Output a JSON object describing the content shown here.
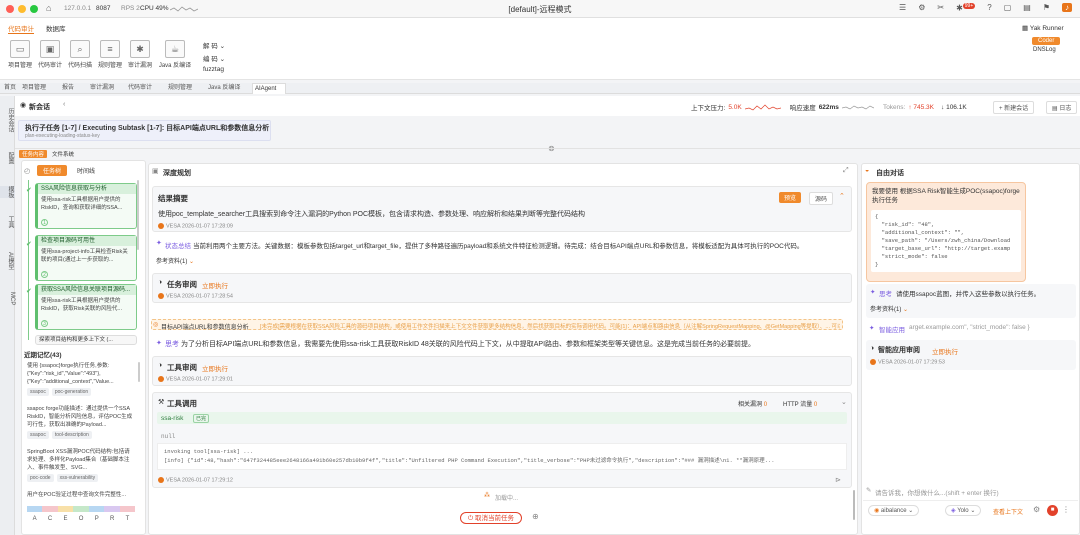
{
  "titlebar": {
    "host": "127.0.0.1",
    "port": "8087",
    "rps": "RPS 2",
    "cpu": "CPU 49%",
    "window_title": "[default]-远程模式",
    "notif_count": "99+"
  },
  "ribbon": {
    "tabs": [
      "代码审计",
      "数据库"
    ],
    "active_tab": "代码审计",
    "items": [
      "项目管理",
      "代码审计",
      "代码扫描",
      "规则管理",
      "审计漏洞",
      "Java 反编译"
    ],
    "dropdowns": [
      "解 码",
      "编 码",
      "fuzztag"
    ],
    "right_title": "Yak Runner",
    "right_badge": "Coder",
    "right_item": "DNSLog"
  },
  "tabs": [
    "首页",
    "项目管理",
    "报告",
    "审计漏洞",
    "代码审计",
    "规则管理",
    "Java 反编译",
    "AIAgent"
  ],
  "active_tab_index": 7,
  "rail": [
    "历史会话",
    "配置",
    "模板",
    "工具",
    "AI模型",
    "MCP"
  ],
  "session": {
    "title": "新会话",
    "pressure_label": "上下文压力:",
    "pressure_value": "5.0K",
    "speed_label": "响应速度",
    "speed_value": "622ms",
    "tokens_label": "Tokens:",
    "tokens_up": "745.3K",
    "tokens_down": "106.1K",
    "new_btn": "新建会话",
    "log_btn": "日志"
  },
  "banner": {
    "title": "执行子任务 [1-7] / Executing Subtask [1-7]: 目标API端点URL和参数信息分析",
    "subtitle": "plan-executing-loading-status-key"
  },
  "left": {
    "tabs": [
      "任务内容",
      "文件系统"
    ],
    "subtabs": [
      "任务树",
      "时间线"
    ],
    "tasks": [
      {
        "title": "SSA风险信息获取与分析",
        "body": "使用ssa-risk工具根据用户提供的RiskID，查询和获取详细的SSA...",
        "n": "1"
      },
      {
        "title": "检查项目源码可用性",
        "body": "使用ssa-project-info工具检查Risk关联的项目(通过上一步获取的...",
        "n": "2"
      },
      {
        "title": "获取SSA风险信息关联项目源码...",
        "body": "使用ssa-risk工具根据用户提供的RiskID，获取Risk关联的风险代...",
        "n": "3"
      }
    ],
    "task4": "探索项目结构和更多上下文 (...",
    "memory_title": "近期记忆(43)",
    "memories": [
      {
        "text": "使用 {ssapoc}forge执行任务,参数: {\"Key\":\"risk_id\",\"Value\":\"493\"},{\"Key\":\"additional_context\",\"Value...",
        "tags": [
          "ssapoc",
          "poc-generation"
        ]
      },
      {
        "text": "ssapoc forge功能描述：通过提供一个SSA RiskID，智能分析风险信息，评估POC生成可行性，获取出准确的Payload...",
        "tags": [
          "ssapoc",
          "tool-description"
        ]
      },
      {
        "text": "SpringBoot XSS漏洞POC代码结构:包括请求处理、多样化Payload集合（基础脚本注入、事件触发型、SVG...",
        "tags": [
          "poc-code",
          "xss-vulnerability"
        ]
      },
      {
        "text": "用户在POC验证过程中查询文件完整性...",
        "tags": []
      }
    ],
    "letters": [
      "A",
      "C",
      "E",
      "O",
      "P",
      "R",
      "T"
    ]
  },
  "mid": {
    "title": "深度规划",
    "result_title": "结果摘要",
    "preview_btn": "预览",
    "source_btn": "源码",
    "result_text": "使用poc_template_searcher工具搜索到命令注入漏洞的Python POC模板，包含请求构造、参数处理、响应解析和结果判断等完整代码结构",
    "meta1": "VESA  2026-01-07 17:28:09",
    "status_label": "状态总结",
    "status_text": "当前利用两个主要方法。关键数据：模板参数包括target_url和target_file，提供了多种路径遍历payload和系统文件特征检测逻辑。待完成：结合目标API端点URL和参数信息，将模板适配为具体可执行的POC代码。",
    "ref1": "参考资料(1)",
    "review_title": "任务审阅",
    "review_action": "立即执行",
    "meta2": "VESA  2026-01-07 17:28:54",
    "progress_label": "目标API端点URL和参数信息分析",
    "progress_text": "[未完成]需要根据在获取SSA风险工具的源码项目结构，或使用工作文件扫描来上下文文件获取更多结构信息，然后找获取目标的实际调用代码。可能(1)：API端点和路由信息（从注解SpringRequestMapping、@GetMapping等提取）、... 可以下载...",
    "think_label": "思考",
    "think_text": "为了分析目标API端点URL和参数信息，我需要先使用ssa-risk工具获取RiskID 48关联的风险代码上下文，从中提取API路由、参数和框架类型等关键信息。这是完成当前任务的必要前提。",
    "tool_review_title": "工具审阅",
    "tool_review_action": "立即执行",
    "meta3": "VESA  2026-01-07 17:29:01",
    "tool_call_title": "工具调用",
    "related": "相关漏洞",
    "related_n": "0",
    "http": "HTTP 流量",
    "http_n": "0",
    "tool_name": "ssa-risk",
    "tool_badge": "已完",
    "null_text": "null",
    "log1": "invoking tool[ssa-risk] ...",
    "log2": "[info] {\"id\":48,\"hash\":\"647f324485eee2648166a491b60e257db10b9f4f\",\"title\":\"Unfiltered PHP Command Execution\",\"title_verbose\":\"PHP未过滤命令执行\",\"description\":\"### 漏洞描述\\n1. **漏洞原理...",
    "meta4": "VESA  2026-01-07 17:29:12",
    "loading": "加载中...",
    "cancel_btn": "取消当前任务"
  },
  "right": {
    "title": "自由对话",
    "user_msg": "我要使用 根据SSA Risk智能生成POC(ssapoc)forge执行任务",
    "code": [
      "{",
      "  \"risk_id\": \"48\",",
      "  \"additional_context\": \"\",",
      "  \"save_path\": \"/Users/zwh_china/Download",
      "  \"target_base_url\": \"http://target.examp",
      "  \"strict_mode\": false",
      "}"
    ],
    "think_label": "思考",
    "think_text": "请使用ssapoc蓝图，并传入这些参数以执行任务。",
    "ref": "参考资料(1)",
    "app_label": "智能应用",
    "app_text": "arget.example.com\", \"strict_mode\": false }",
    "review_title": "智能应用审阅",
    "review_action": "立即执行",
    "meta": "VESA  2026-01-07 17:29:53",
    "input_placeholder": "请告诉我，你想做什么...(shift + enter 换行)",
    "model": "aibalance",
    "mode": "Yolo",
    "context_btn": "查看上下文"
  },
  "colors": {
    "accent": "#e8751a",
    "green": "#5fbf6e",
    "purple": "#7a5ce0"
  }
}
